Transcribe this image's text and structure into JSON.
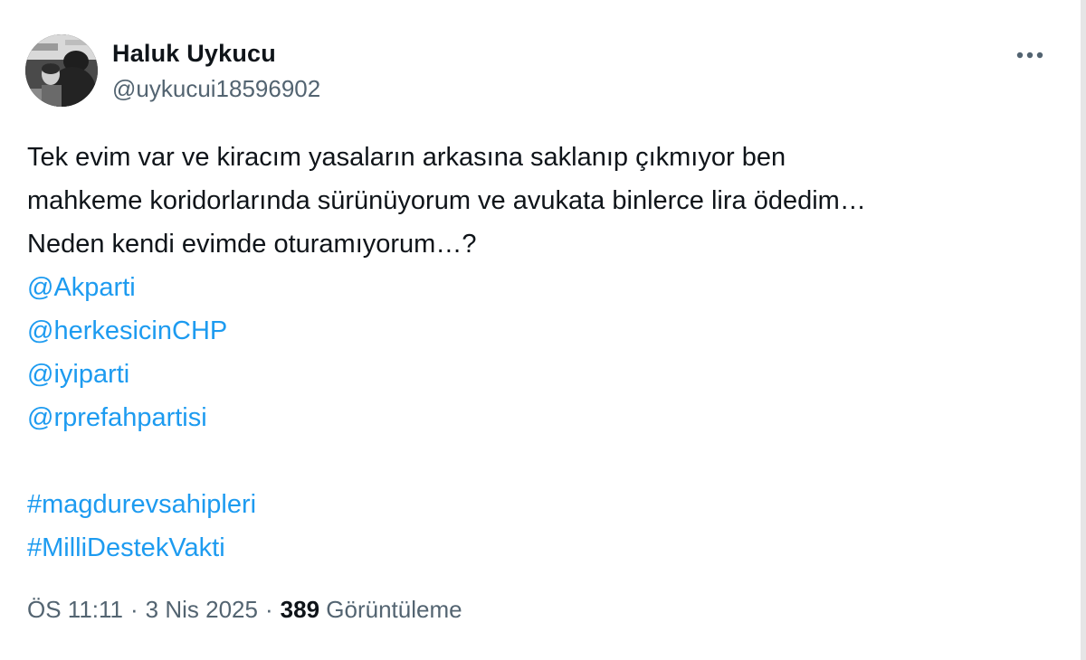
{
  "author": {
    "name": "Haluk Uykucu",
    "handle": "@uykucui18596902"
  },
  "tweet": {
    "text_lines": [
      "Tek evim var ve kiracım yasaların arkasına saklanıp çıkmıyor ben",
      "mahkeme koridorlarında sürünüyorum ve avukata binlerce lira ödedim…",
      "Neden kendi evimde oturamıyorum…?"
    ],
    "mentions": [
      "@Akparti",
      "@herkesicinCHP",
      "@iyiparti",
      "@rprefahpartisi"
    ],
    "hashtags": [
      "#magdurevsahipleri",
      "#MilliDestekVakti"
    ]
  },
  "meta": {
    "time": "ÖS 11:11",
    "separator": "·",
    "date": "3 Nis 2025",
    "views_count": "389",
    "views_label": "Görüntüleme"
  },
  "icons": {
    "more": "more-horizontal-icon",
    "avatar": "profile-photo"
  },
  "colors": {
    "link": "#1d9bf0",
    "text": "#0f1419",
    "secondary": "#536471"
  }
}
